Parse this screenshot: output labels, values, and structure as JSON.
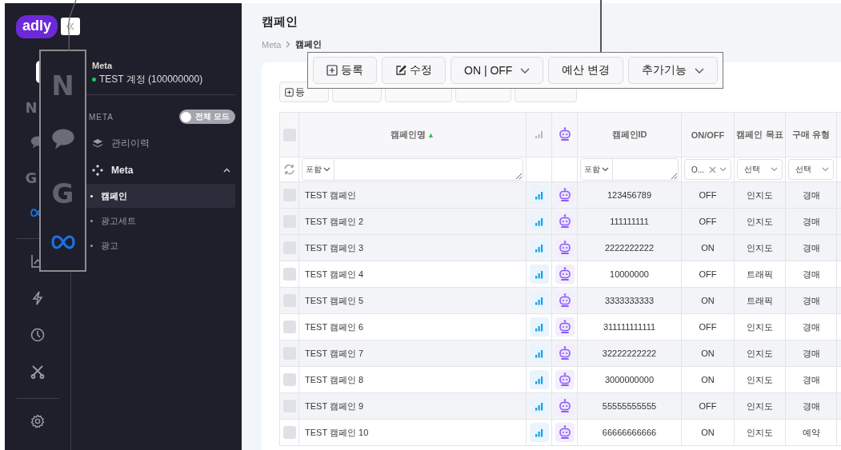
{
  "brand": {
    "logo": "adly"
  },
  "rail": {
    "items": [
      {
        "kind": "account",
        "selected": true
      },
      {
        "kind": "naver",
        "glyph": "N",
        "selected": false
      },
      {
        "kind": "kakao",
        "selected": false
      },
      {
        "kind": "google",
        "glyph": "G",
        "selected": false
      },
      {
        "kind": "meta",
        "selected": false
      },
      {
        "kind": "divider"
      },
      {
        "kind": "chart",
        "selected": false
      },
      {
        "kind": "bolt",
        "selected": false
      },
      {
        "kind": "clock",
        "selected": false
      },
      {
        "kind": "tools",
        "selected": false
      },
      {
        "kind": "divider"
      },
      {
        "kind": "gear",
        "selected": false
      }
    ]
  },
  "callout_icons": [
    {
      "kind": "naver",
      "glyph": "N"
    },
    {
      "kind": "kakao"
    },
    {
      "kind": "google",
      "glyph": "G"
    },
    {
      "kind": "meta"
    }
  ],
  "account": {
    "platform": "Meta",
    "name": "TEST 계정 (100000000)",
    "connected": true
  },
  "section": {
    "label": "META",
    "toggle": {
      "label": "전체 모드",
      "on": false
    }
  },
  "nav": [
    {
      "kind": "history",
      "label": "관리이력"
    },
    {
      "kind": "meta",
      "label": "Meta",
      "expanded": true,
      "children": [
        {
          "label": "캠페인",
          "selected": true
        },
        {
          "label": "광고세트",
          "selected": false
        },
        {
          "label": "광고",
          "selected": false
        }
      ]
    }
  ],
  "page": {
    "title": "캠페인",
    "breadcrumb": [
      "Meta",
      "캠페인"
    ]
  },
  "toolbar_under": {
    "first_label": "등"
  },
  "toolbar": [
    {
      "kind": "add",
      "label": "등록"
    },
    {
      "kind": "edit",
      "label": "수정"
    },
    {
      "kind": "dropdown",
      "label": "ON | OFF"
    },
    {
      "kind": "plain",
      "label": "예산 변경"
    },
    {
      "kind": "dropdown",
      "label": "추가기능"
    }
  ],
  "table": {
    "columns": [
      {
        "kind": "check",
        "checked": false
      },
      {
        "kind": "text",
        "label": "캠페인명",
        "sort_icon": "▲"
      },
      {
        "kind": "chart"
      },
      {
        "kind": "bot"
      },
      {
        "kind": "text",
        "label": "캠페인ID"
      },
      {
        "kind": "text",
        "label": "ON/OFF"
      },
      {
        "kind": "text",
        "label": "캠페인 목표"
      },
      {
        "kind": "text",
        "label": "구매 유형"
      }
    ],
    "filters": [
      {
        "kind": "refresh"
      },
      {
        "kind": "match",
        "op": "포함"
      },
      {
        "kind": "none"
      },
      {
        "kind": "none"
      },
      {
        "kind": "match",
        "op": "포함"
      },
      {
        "kind": "status",
        "value": "O..."
      },
      {
        "kind": "select",
        "value": "선택"
      },
      {
        "kind": "select",
        "value": "선택"
      }
    ],
    "rows": [
      {
        "name": "TEST 캠페인",
        "id": "123456789",
        "status": "OFF",
        "goal": "인지도",
        "type": "경매",
        "shaded": true
      },
      {
        "name": "TEST 캠페인 2",
        "id": "111111111",
        "status": "OFF",
        "goal": "인지도",
        "type": "경매",
        "shaded": true
      },
      {
        "name": "TEST 캠페인 3",
        "id": "2222222222",
        "status": "ON",
        "goal": "인지도",
        "type": "경매",
        "shaded": true
      },
      {
        "name": "TEST 캠페인 4",
        "id": "10000000",
        "status": "OFF",
        "goal": "트래픽",
        "type": "경매",
        "shaded": false
      },
      {
        "name": "TEST 캠페인 5",
        "id": "3333333333",
        "status": "ON",
        "goal": "트래픽",
        "type": "경매",
        "shaded": true
      },
      {
        "name": "TEST 캠페인 6",
        "id": "311111111111",
        "status": "OFF",
        "goal": "인지도",
        "type": "경매",
        "shaded": false
      },
      {
        "name": "TEST 캠페인 7",
        "id": "32222222222",
        "status": "ON",
        "goal": "인지도",
        "type": "경매",
        "shaded": true
      },
      {
        "name": "TEST 캠페인 8",
        "id": "3000000000",
        "status": "ON",
        "goal": "인지도",
        "type": "경매",
        "shaded": false
      },
      {
        "name": "TEST 캠페인 9",
        "id": "55555555555",
        "status": "OFF",
        "goal": "인지도",
        "type": "경매",
        "shaded": true
      },
      {
        "name": "TEST 캠페인 10",
        "id": "66666666666",
        "status": "ON",
        "goal": "인지도",
        "type": "예약",
        "shaded": false
      }
    ]
  }
}
